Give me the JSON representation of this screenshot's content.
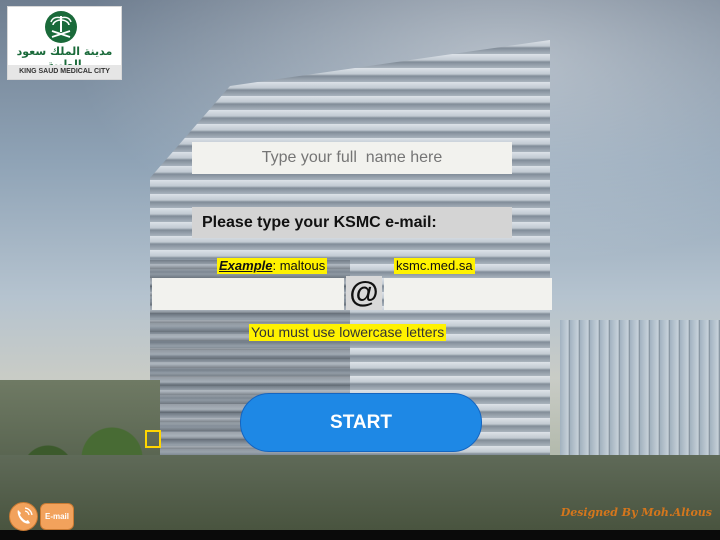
{
  "logo": {
    "arabic": "مدينة الملك سعود الطبية",
    "english": "KING SAUD MEDICAL CITY",
    "icon": "palm-swords-emblem-icon"
  },
  "form": {
    "name_placeholder": "Type your full  name here",
    "email_label": "Please type your KSMC e-mail:",
    "example_label": "Example",
    "example_value": ": maltous",
    "domain_hint": "ksmc.med.sa",
    "at_symbol": "@",
    "lowercase_note": "You must use lowercase letters"
  },
  "start_button": "START",
  "footer": {
    "phone_icon": "phone-icon",
    "email_button": "E-mail",
    "credit": "Designed By Moh.Altous"
  },
  "colors": {
    "highlight": "#fff200",
    "start_button": "#1e88e5",
    "footer_button": "#f2a25c"
  }
}
